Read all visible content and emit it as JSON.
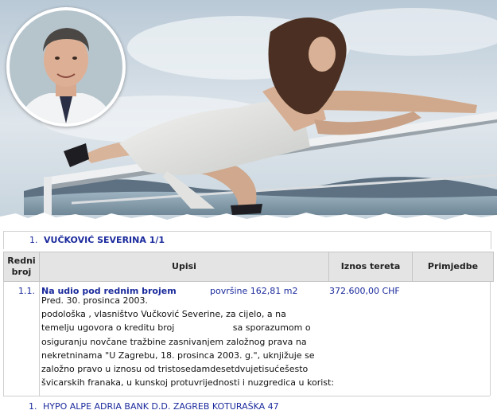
{
  "registry": {
    "owner": {
      "number": "1.",
      "name": "VUČKOVIĆ SEVERINA 1/1"
    },
    "headers": {
      "redni_broj": "Redni broj",
      "upisi": "Upisi",
      "iznos_tereta": "Iznos tereta",
      "primjedbe": "Primjedbe"
    },
    "entry": {
      "number": "1.1.",
      "title": "Na udio pod rednim brojem",
      "area": "površine 162,81 m2",
      "amount": "372.600,00 CHF",
      "lines": [
        "Pred. 30. prosinca 2003.",
        "podološka , vlasništvo Vučković Severine, za cijelo, a na",
        "temelju ugovora o kreditu broj                     sa sporazumom o",
        "osiguranju novčane tražbine zasnivanjem založnog prava na",
        "nekretninama \"U Zagrebu, 18. prosinca 2003. g.\", uknjižuje se",
        "založno pravo u iznosu od tristosedamdesetdvujetisućešesto",
        "švicarskih franaka, u kunskoj protuvrijednosti i nuzgredica u korist:"
      ]
    },
    "creditor": {
      "number": "1.",
      "name": "HYPO ALPE ADRIA BANK D.D. ZAGREB KOTURAŠKA 47"
    }
  },
  "colors": {
    "link_blue": "#1a2a9c",
    "header_bg": "#e4e4e4",
    "sky": "#c9d6e0"
  },
  "icons": {
    "photo": "woman-on-railing-photo",
    "portrait": "man-portrait-photo"
  }
}
